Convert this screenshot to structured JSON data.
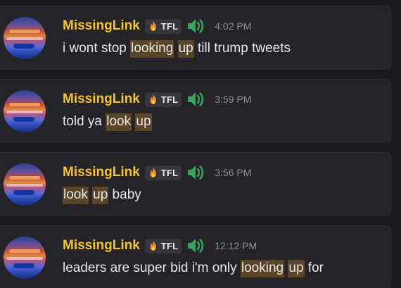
{
  "messages": [
    {
      "author": "MissingLink",
      "tag": "TFL",
      "time": "4:02 PM",
      "parts": [
        {
          "text": "i wont stop ",
          "hl": false
        },
        {
          "text": "looking",
          "hl": true
        },
        {
          "text": " ",
          "hl": false
        },
        {
          "text": "up",
          "hl": true
        },
        {
          "text": " till trump tweets",
          "hl": false
        }
      ]
    },
    {
      "author": "MissingLink",
      "tag": "TFL",
      "time": "3:59 PM",
      "parts": [
        {
          "text": "told ya ",
          "hl": false
        },
        {
          "text": "look",
          "hl": true
        },
        {
          "text": " ",
          "hl": false
        },
        {
          "text": "up",
          "hl": true
        }
      ]
    },
    {
      "author": "MissingLink",
      "tag": "TFL",
      "time": "3:56 PM",
      "parts": [
        {
          "text": "look",
          "hl": true
        },
        {
          "text": " ",
          "hl": false
        },
        {
          "text": "up",
          "hl": true
        },
        {
          "text": " baby",
          "hl": false
        }
      ]
    },
    {
      "author": "MissingLink",
      "tag": "TFL",
      "time": "12:12 PM",
      "parts": [
        {
          "text": "leaders are super bid i'm only ",
          "hl": false
        },
        {
          "text": "looking",
          "hl": true
        },
        {
          "text": " ",
          "hl": false
        },
        {
          "text": "up",
          "hl": true
        },
        {
          "text": " for",
          "hl": false
        }
      ]
    }
  ],
  "icons": {
    "tag_icon": "flame-icon",
    "status_icon": "speaker-icon"
  },
  "colors": {
    "background": "#1a1a1e",
    "card": "#242429",
    "username": "#f0c33c",
    "highlight": "#5a4626",
    "timestamp": "#8c8e95",
    "speaker": "#3ba55c"
  }
}
